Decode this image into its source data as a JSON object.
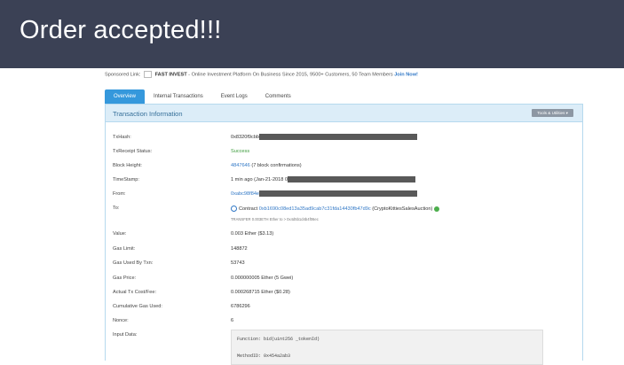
{
  "banner": {
    "title": "Order accepted!!!"
  },
  "sponsor": {
    "prefix": "Sponsored Link:",
    "brand": "FAST INVEST",
    "text": " - Online Investment Platform On Business Since 2015, 9500+ Customers, 50 Team Members",
    "link": "Join Now!"
  },
  "tabs": [
    "Overview",
    "Internal Transactions",
    "Event Logs",
    "Comments"
  ],
  "panel": {
    "title": "Transaction Information",
    "tools_label": "Tools & Utilities ▾"
  },
  "rows": [
    {
      "label": "TxHash:",
      "value": "0x8320f9cbb"
    },
    {
      "label": "TxReceipt Status:",
      "value": "Success"
    },
    {
      "label": "Block Height:",
      "value": "4847646",
      "extra": " (7 block confirmations)"
    },
    {
      "label": "TimeStamp:",
      "value": "1 min ago (Jan-21-2018 0"
    },
    {
      "label": "From:",
      "value": "0xabc98f84e"
    },
    {
      "label": "To:",
      "prefix": "Contract ",
      "value": "0xb1690c08ed13a35ad9cab7c31fda14430fb47d9c",
      "extra": " (CryptoKittiesSalesAuction)"
    },
    {
      "label": "Value:",
      "value": "0.003 Ether ($3.13)"
    },
    {
      "label": "Gas Limit:",
      "value": "148872"
    },
    {
      "label": "Gas Used By Txn:",
      "value": "53743"
    },
    {
      "label": "Gas Price:",
      "value": "0.000000005 Ether (5 Gwei)"
    },
    {
      "label": "Actual Tx Cost/Fee:",
      "value": "0.000268715 Ether ($0.28)"
    },
    {
      "label": "Cumulative Gas Used:",
      "value": "6786296"
    },
    {
      "label": "Nonce:",
      "value": "6"
    },
    {
      "label": "Input Data:",
      "value": ""
    }
  ],
  "to_sub": "TRANSFER 0.003ETH Ether to > 0x4d5b1d4b4f06ec",
  "input_data": {
    "line1": "Function: bid(uint256 _tokenId)",
    "line2": "MethodID: 0x454a2ab3"
  },
  "colors": {
    "banner": "#3b4155",
    "accent": "#3598dc",
    "link": "#3178c6",
    "success": "#3a9a3a"
  }
}
